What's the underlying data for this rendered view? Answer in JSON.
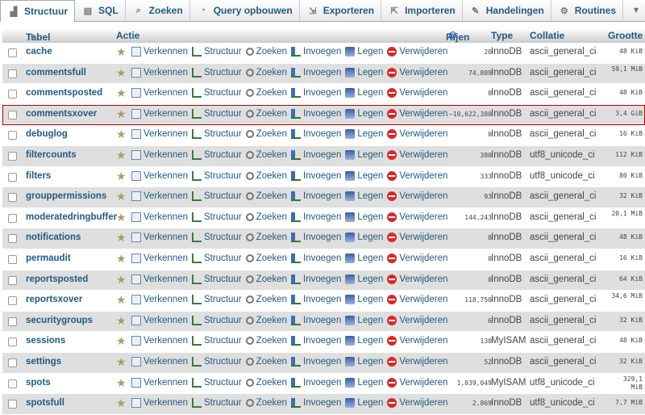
{
  "tabs": [
    {
      "label": "Structuur",
      "icon": "structure-icon",
      "active": true
    },
    {
      "label": "SQL",
      "icon": "sql-icon"
    },
    {
      "label": "Zoeken",
      "icon": "search-icon"
    },
    {
      "label": "Query opbouwen",
      "icon": "query-icon"
    },
    {
      "label": "Exporteren",
      "icon": "export-icon"
    },
    {
      "label": "Importeren",
      "icon": "import-icon"
    },
    {
      "label": "Handelingen",
      "icon": "wrench-icon"
    },
    {
      "label": "Routines",
      "icon": "routines-icon"
    },
    {
      "label": "Meer",
      "icon": "chevron-down-icon"
    }
  ],
  "header": {
    "tabel": "Tabel",
    "actie": "Actie",
    "rijen": "Rijen",
    "type": "Type",
    "collatie": "Collatie",
    "grootte": "Grootte"
  },
  "actions": {
    "browse": "Verkennen",
    "structure": "Structuur",
    "search": "Zoeken",
    "insert": "Invoegen",
    "empty": "Legen",
    "drop": "Verwijderen"
  },
  "rows": [
    {
      "name": "cache",
      "rows": "20",
      "type": "InnoDB",
      "coll": "ascii_general_ci",
      "size": "48 KiB"
    },
    {
      "name": "commentsfull",
      "rows": "74,809",
      "type": "InnoDB",
      "coll": "ascii_general_ci",
      "size": "59,1 MiB"
    },
    {
      "name": "commentsposted",
      "rows": "0",
      "type": "InnoDB",
      "coll": "ascii_general_ci",
      "size": "48 KiB"
    },
    {
      "name": "commentsxover",
      "rows": "~10,622,380",
      "type": "InnoDB",
      "coll": "ascii_general_ci",
      "size": "3,4 GiB",
      "selected": true
    },
    {
      "name": "debuglog",
      "rows": "0",
      "type": "InnoDB",
      "coll": "ascii_general_ci",
      "size": "16 KiB"
    },
    {
      "name": "filtercounts",
      "rows": "380",
      "type": "InnoDB",
      "coll": "utf8_unicode_ci",
      "size": "112 KiB"
    },
    {
      "name": "filters",
      "rows": "333",
      "type": "InnoDB",
      "coll": "utf8_unicode_ci",
      "size": "80 KiB"
    },
    {
      "name": "grouppermissions",
      "rows": "93",
      "type": "InnoDB",
      "coll": "ascii_general_ci",
      "size": "32 KiB"
    },
    {
      "name": "moderatedringbuffer",
      "rows": "144,243",
      "type": "InnoDB",
      "coll": "ascii_general_ci",
      "size": "20,1 MiB"
    },
    {
      "name": "notifications",
      "rows": "0",
      "type": "InnoDB",
      "coll": "ascii_general_ci",
      "size": "48 KiB"
    },
    {
      "name": "permaudit",
      "rows": "0",
      "type": "InnoDB",
      "coll": "ascii_general_ci",
      "size": "16 KiB"
    },
    {
      "name": "reportsposted",
      "rows": "0",
      "type": "InnoDB",
      "coll": "ascii_general_ci",
      "size": "64 KiB"
    },
    {
      "name": "reportsxover",
      "rows": "118,750",
      "type": "InnoDB",
      "coll": "ascii_general_ci",
      "size": "34,6 MiB"
    },
    {
      "name": "securitygroups",
      "rows": "6",
      "type": "InnoDB",
      "coll": "ascii_general_ci",
      "size": "32 KiB"
    },
    {
      "name": "sessions",
      "rows": "130",
      "type": "MyISAM",
      "coll": "ascii_general_ci",
      "size": "48 KiB"
    },
    {
      "name": "settings",
      "rows": "52",
      "type": "InnoDB",
      "coll": "ascii_general_ci",
      "size": "32 KiB"
    },
    {
      "name": "spots",
      "rows": "1,039,049",
      "type": "MyISAM",
      "coll": "utf8_unicode_ci",
      "size": "329,1 MiB"
    },
    {
      "name": "spotsfull",
      "rows": "2,869",
      "type": "InnoDB",
      "coll": "utf8_unicode_ci",
      "size": "7,7 MiB"
    }
  ]
}
